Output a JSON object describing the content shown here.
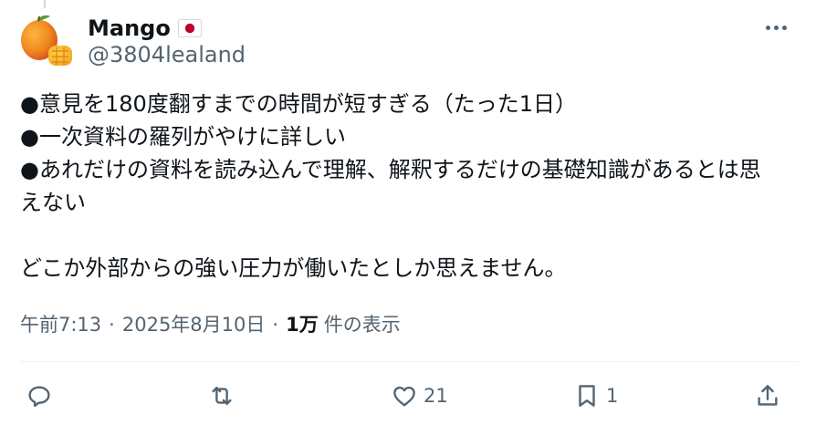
{
  "author": {
    "display_name": "Mango",
    "flag_icon": "japan-flag",
    "handle": "@3804lealand",
    "avatar_icon": "mango-avatar"
  },
  "post": {
    "lines": [
      "●意見を180度翻すまでの時間が短すぎる（たった1日）",
      "●一次資料の羅列がやけに詳しい",
      "●あれだけの資料を読み込んで理解、解釈するだけの基礎知識があるとは思",
      "えない",
      "",
      "どこか外部からの強い圧力が働いたとしか思えません。"
    ]
  },
  "meta": {
    "time": "午前7:13",
    "separator": "·",
    "date": "2025年8月10日",
    "views_count": "1万",
    "views_label": "件の表示"
  },
  "actions": {
    "reply_icon": "reply-icon",
    "repost_icon": "repost-icon",
    "like_icon": "heart-icon",
    "like_count": "21",
    "bookmark_icon": "bookmark-icon",
    "bookmark_count": "1",
    "share_icon": "share-icon"
  },
  "colors": {
    "text_primary": "#0f1419",
    "text_secondary": "#536471",
    "divider": "#eff3f4",
    "mango_orange": "#f08a1c",
    "leaf_green": "#5aa02c",
    "flag_red": "#bc002d"
  }
}
